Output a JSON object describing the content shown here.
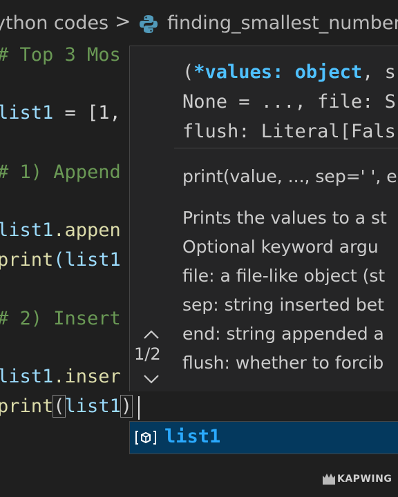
{
  "breadcrumb": {
    "folder": "ython codes",
    "separator": ">",
    "file": "finding_smallest_number_i",
    "file_icon": "python-icon"
  },
  "code": {
    "line1": "# Top 3 Mos",
    "line2_var": "list1",
    "line2_rest": " = [1,",
    "line3": "# 1) Append",
    "line4_var": "list1",
    "line4_rest": ".appen",
    "line5_fn": "print",
    "line5_rest": "(list1",
    "line6": "# 2) Insert",
    "line7_var": "list1",
    "line7_rest": ".inser",
    "line8_fn": "print",
    "line8_paren": "(",
    "line8_arg": "list1",
    "line8_close": ")"
  },
  "hover": {
    "sig_line1_open": "(",
    "sig_line1_param": "*values",
    "sig_line1_colon": ": ",
    "sig_line1_type": "object",
    "sig_line1_rest": ", s",
    "sig_line2": "None = ..., file: S",
    "sig_line3": "flush: Literal[Fals",
    "doc_sig": "print(value, ..., sep=' ', e",
    "doc_lines": [
      "Prints the values to a st",
      "Optional keyword argu",
      "file: a file-like object (st",
      "sep: string inserted bet",
      "end: string appended a",
      "flush: whether to forcib"
    ],
    "overload_counter": "1/2"
  },
  "suggestion": {
    "label": "list1",
    "icon": "variable-icon"
  },
  "watermark": {
    "text": "KAPWING"
  }
}
